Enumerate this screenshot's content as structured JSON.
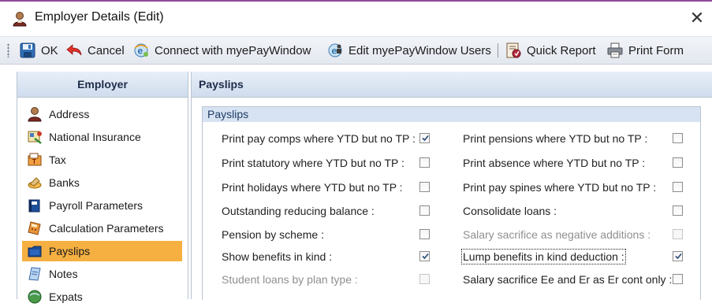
{
  "window": {
    "title": "Employer Details (Edit)",
    "close_glyph": "✕"
  },
  "toolbar": {
    "ok_label": "OK",
    "cancel_label": "Cancel",
    "connect_label": "Connect with myePayWindow",
    "edit_users_label": "Edit myePayWindow Users",
    "quick_report_label": "Quick Report",
    "print_form_label": "Print Form"
  },
  "sidebar": {
    "header": "Employer",
    "items": [
      {
        "label": "Address",
        "icon": "person-icon"
      },
      {
        "label": "National Insurance",
        "icon": "national-insurance-icon"
      },
      {
        "label": "Tax",
        "icon": "tax-icon"
      },
      {
        "label": "Banks",
        "icon": "banks-icon"
      },
      {
        "label": "Payroll Parameters",
        "icon": "book-icon"
      },
      {
        "label": "Calculation Parameters",
        "icon": "calculator-icon"
      },
      {
        "label": "Payslips",
        "icon": "folder-icon",
        "active": true
      },
      {
        "label": "Notes",
        "icon": "notes-icon"
      },
      {
        "label": "Expats",
        "icon": "globe-icon"
      }
    ]
  },
  "main": {
    "header": "Payslips",
    "group_title": "Payslips",
    "left_options": [
      {
        "label": "Print pay comps where YTD but no TP :",
        "checked": true,
        "disabled": false
      },
      {
        "label": "Print statutory where YTD but no TP :",
        "checked": false,
        "disabled": false
      },
      {
        "label": "Print holidays where YTD but no TP :",
        "checked": false,
        "disabled": false
      },
      {
        "label": "Outstanding reducing balance :",
        "checked": false,
        "disabled": false
      },
      {
        "label": "Pension by scheme :",
        "checked": false,
        "disabled": false
      },
      {
        "label": "Show benefits in kind :",
        "checked": true,
        "disabled": false
      },
      {
        "label": "Student loans by plan type :",
        "checked": false,
        "disabled": true
      }
    ],
    "right_options": [
      {
        "label": "Print pensions where YTD but no TP :",
        "checked": false,
        "disabled": false
      },
      {
        "label": "Print absence where YTD but no TP :",
        "checked": false,
        "disabled": false
      },
      {
        "label": "Print pay spines where YTD but no TP :",
        "checked": false,
        "disabled": false
      },
      {
        "label": "Consolidate loans :",
        "checked": false,
        "disabled": false
      },
      {
        "label": "Salary sacrifice as negative additions :",
        "checked": false,
        "disabled": true
      },
      {
        "label": "Lump benefits in kind deduction :",
        "checked": true,
        "disabled": false,
        "focused": true
      },
      {
        "label": "Salary sacrifice Ee and Er as Er cont only :",
        "checked": false,
        "disabled": false
      }
    ]
  },
  "colors": {
    "accent_active": "#f6b042",
    "window_border": "#8e4a9b",
    "panel_header": "#cfdcee"
  }
}
